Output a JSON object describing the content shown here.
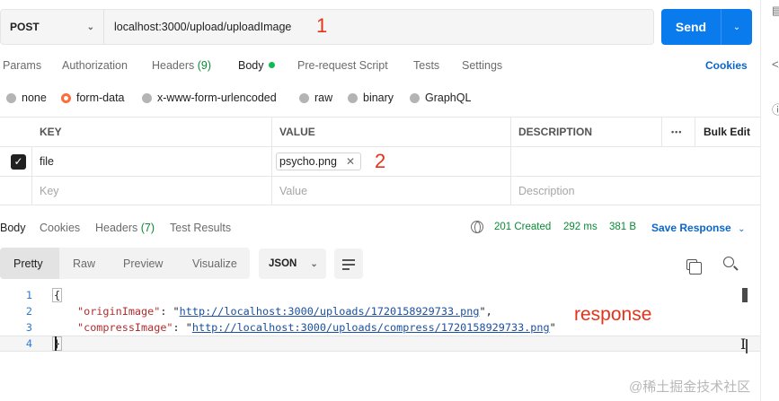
{
  "request": {
    "method": "POST",
    "url": "localhost:3000/upload/uploadImage",
    "send_label": "Send",
    "annotation_1": "1"
  },
  "request_tabs": [
    {
      "label": "Params"
    },
    {
      "label": "Authorization"
    },
    {
      "label": "Headers",
      "count": "(9)"
    },
    {
      "label": "Body",
      "active": true
    },
    {
      "label": "Pre-request Script"
    },
    {
      "label": "Tests"
    },
    {
      "label": "Settings"
    }
  ],
  "cookies_label": "Cookies",
  "body_types": [
    {
      "label": "none",
      "selected": false
    },
    {
      "label": "form-data",
      "selected": true
    },
    {
      "label": "x-www-form-urlencoded",
      "selected": false
    },
    {
      "label": "raw",
      "selected": false
    },
    {
      "label": "binary",
      "selected": false
    },
    {
      "label": "GraphQL",
      "selected": false
    }
  ],
  "params_table": {
    "headers": {
      "key": "KEY",
      "value": "VALUE",
      "description": "DESCRIPTION",
      "more": "•••",
      "bulk_edit": "Bulk Edit"
    },
    "rows": [
      {
        "checked": true,
        "key": "file",
        "value_file": "psycho.png",
        "annotation": "2"
      }
    ],
    "placeholders": {
      "key": "Key",
      "value": "Value",
      "description": "Description"
    }
  },
  "response_tabs": [
    {
      "label": "Body",
      "active": true
    },
    {
      "label": "Cookies"
    },
    {
      "label": "Headers",
      "count": "(7)"
    },
    {
      "label": "Test Results"
    }
  ],
  "response_meta": {
    "status": "201 Created",
    "time": "292 ms",
    "size": "381 B",
    "save_label": "Save Response"
  },
  "view_modes": [
    "Pretty",
    "Raw",
    "Preview",
    "Visualize"
  ],
  "format_label": "JSON",
  "response_code": {
    "line_numbers": [
      "1",
      "2",
      "3",
      "4"
    ],
    "open_brace": "{",
    "close_brace": "}",
    "lines": [
      {
        "key": "\"originImage\"",
        "value": "http://localhost:3000/uploads/1720158929733.png",
        "trail": ","
      },
      {
        "key": "\"compressImage\"",
        "value": "http://localhost:3000/uploads/compress/1720158929733.png",
        "trail": ""
      }
    ]
  },
  "annotation_response": "response",
  "watermark": "@稀土掘金技术社区",
  "colors": {
    "send": "#097bed",
    "status_green": "#0a8a35",
    "link_blue": "#0b66c9",
    "annotation_red": "#e5331b",
    "radio_selected": "#ff6c37"
  }
}
